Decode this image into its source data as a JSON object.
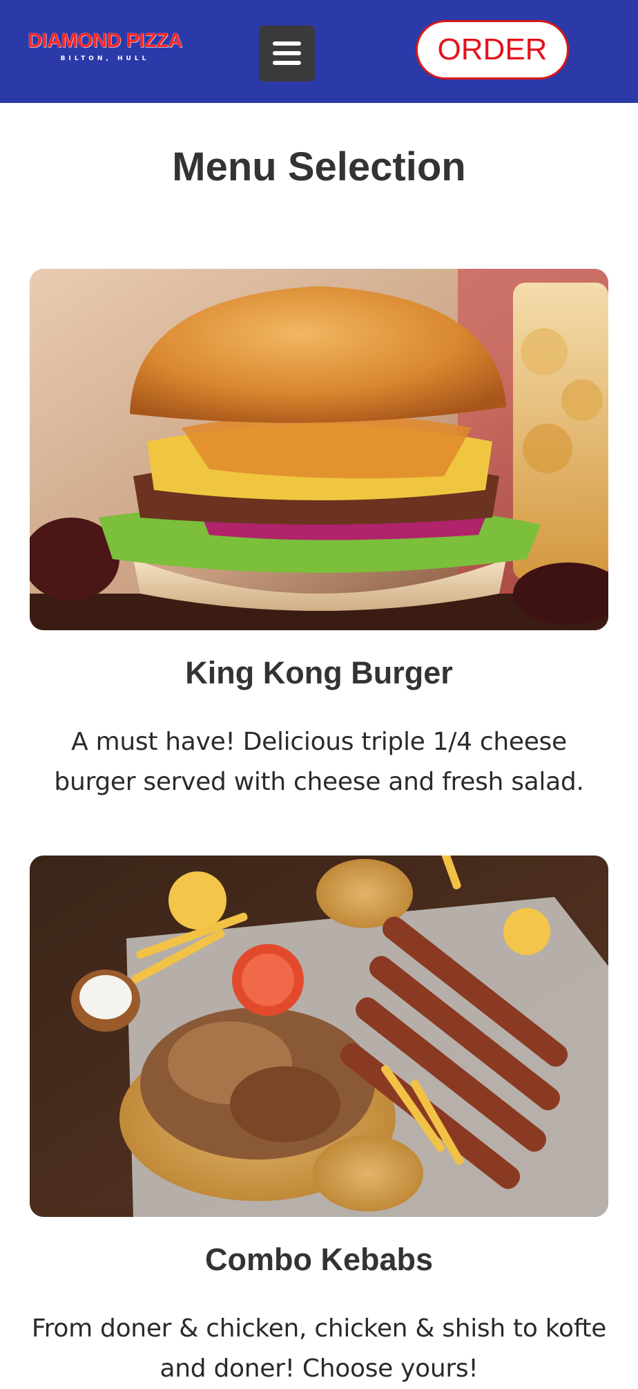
{
  "header": {
    "logo_title": "DIAMOND PIZZA",
    "logo_subtitle": "BILTON, HULL",
    "order_label": "ORDER",
    "background_color": "#2b3aa8",
    "logo_color": "#ff2424"
  },
  "main": {
    "title": "Menu Selection",
    "items": [
      {
        "name": "King Kong Burger",
        "description": "A must have! Delicious triple 1/4 cheese burger served with cheese and fresh salad.",
        "image_icon": "burger-photo"
      },
      {
        "name": "Combo Kebabs",
        "description": "From doner & chicken, chicken & shish to kofte and doner! Choose yours!",
        "image_icon": "kebab-platter-photo"
      }
    ]
  }
}
